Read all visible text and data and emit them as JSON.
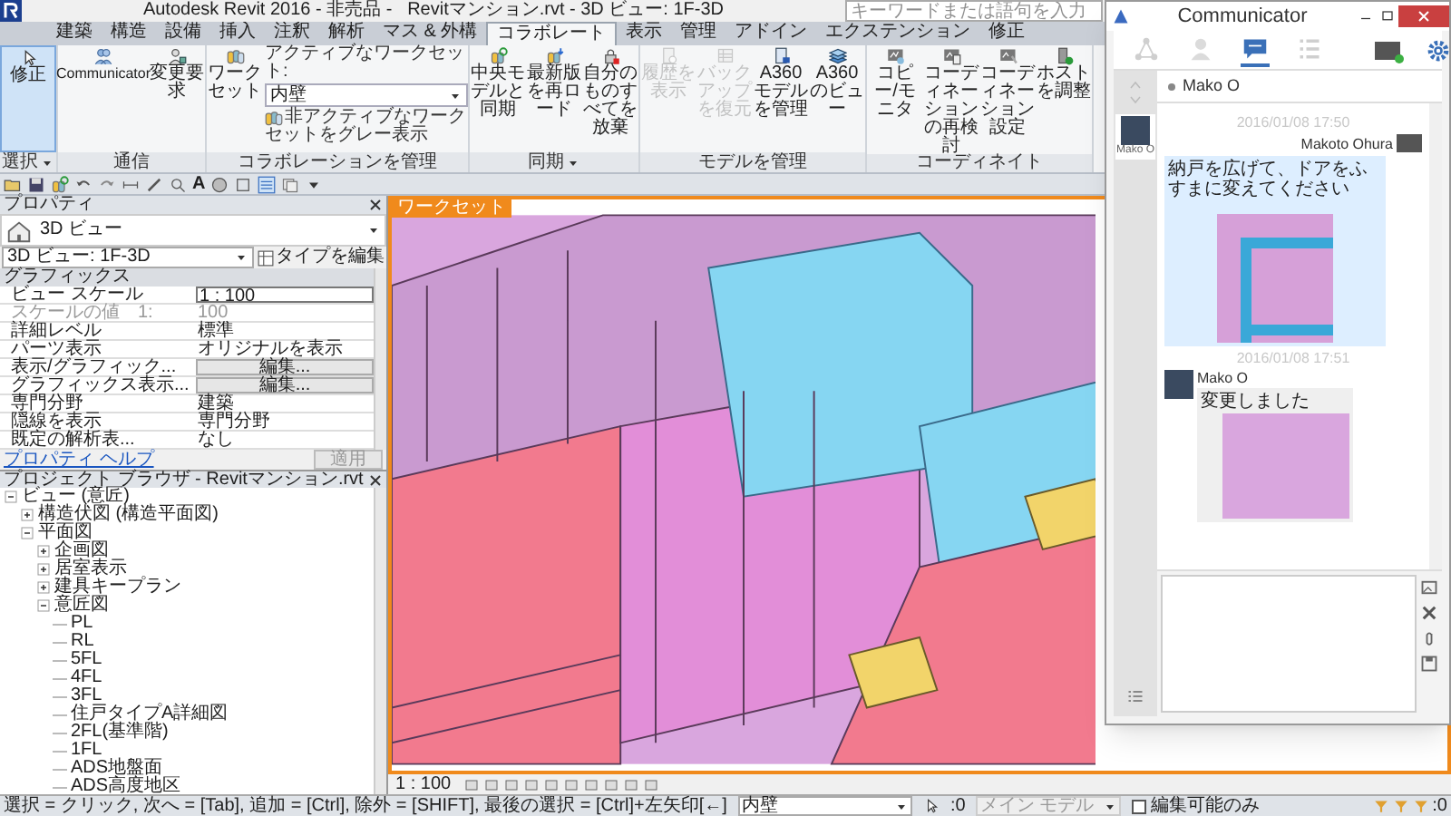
{
  "window": {
    "title": "Autodesk Revit 2016 - 非売品 -   Revitマンション.rvt - 3D ビュー: 1F-3D"
  },
  "search": {
    "placeholder": "キーワードまたは語句を入力"
  },
  "ribbon": {
    "tabs": [
      {
        "label": "建築",
        "selected": false
      },
      {
        "label": "構造",
        "selected": false
      },
      {
        "label": "設備",
        "selected": false
      },
      {
        "label": "挿入",
        "selected": false
      },
      {
        "label": "注釈",
        "selected": false
      },
      {
        "label": "解析",
        "selected": false
      },
      {
        "label": "マス & 外構",
        "selected": false
      },
      {
        "label": "コラボレート",
        "selected": true
      },
      {
        "label": "表示",
        "selected": false
      },
      {
        "label": "管理",
        "selected": false
      },
      {
        "label": "アドイン",
        "selected": false
      },
      {
        "label": "エクステンション",
        "selected": false
      },
      {
        "label": "修正",
        "selected": false
      }
    ],
    "groups": [
      {
        "title": "選択",
        "menu": true,
        "items": [
          {
            "kind": "button",
            "label": "修正",
            "selected": true,
            "disabled": false
          }
        ]
      },
      {
        "title": "通信",
        "menu": false,
        "items": [
          {
            "kind": "button",
            "label": "Communicator",
            "selected": false,
            "disabled": false
          },
          {
            "kind": "button",
            "label": "変更要求",
            "selected": false,
            "disabled": false
          }
        ]
      },
      {
        "title": "コラボレーションを管理",
        "menu": false,
        "items": [
          {
            "kind": "button",
            "label": "ワークセット",
            "selected": false,
            "disabled": false
          },
          {
            "kind": "workset",
            "label": "アクティブなワークセット:",
            "value": "内壁",
            "option": "非アクティブなワークセットをグレー表示"
          }
        ]
      },
      {
        "title": "同期",
        "menu": true,
        "items": [
          {
            "kind": "button",
            "label": "中央モデルと同期",
            "selected": false,
            "disabled": false
          },
          {
            "kind": "button",
            "label": "最新版を再ロード",
            "selected": false,
            "disabled": false
          },
          {
            "kind": "button",
            "label": "自分のものすべてを放棄",
            "selected": false,
            "disabled": false
          }
        ]
      },
      {
        "title": "モデルを管理",
        "menu": false,
        "items": [
          {
            "kind": "button",
            "label": "履歴を表示",
            "selected": false,
            "disabled": true
          },
          {
            "kind": "button",
            "label": "バックアップを復元",
            "selected": false,
            "disabled": true
          },
          {
            "kind": "button",
            "label": "A360 モデルを管理",
            "selected": false,
            "disabled": false
          },
          {
            "kind": "button",
            "label": "A360 のビュー",
            "selected": false,
            "disabled": false
          }
        ]
      },
      {
        "title": "コーディネイト",
        "menu": false,
        "items": [
          {
            "kind": "button",
            "label": "コピー/モニタ",
            "selected": false,
            "disabled": false
          },
          {
            "kind": "button",
            "label": "コーディネーションの再検討",
            "selected": false,
            "disabled": false
          },
          {
            "kind": "button",
            "label": "コーディネーション設定",
            "selected": false,
            "disabled": false
          },
          {
            "kind": "button",
            "label": "ホストを調整",
            "selected": false,
            "disabled": false
          }
        ]
      }
    ]
  },
  "quick_access": {
    "text_tool": "A"
  },
  "properties": {
    "title": "プロパティ",
    "type": "3D ビュー",
    "instance": "3D ビュー: 1F-3D",
    "edit_type": "タイプを編集",
    "section": "グラフィックス",
    "rows": [
      {
        "kind": "input",
        "name": "ビュー スケール",
        "value": "1 : 100"
      },
      {
        "kind": "readonly",
        "name": "スケールの値　1:",
        "value": "100"
      },
      {
        "kind": "text",
        "name": "詳細レベル",
        "value": "標準"
      },
      {
        "kind": "text",
        "name": "パーツ表示",
        "value": "オリジナルを表示"
      },
      {
        "kind": "button",
        "name": "表示/グラフィック...",
        "value": "編集..."
      },
      {
        "kind": "button",
        "name": "グラフィックス表示...",
        "value": "編集..."
      },
      {
        "kind": "text",
        "name": "専門分野",
        "value": "建築"
      },
      {
        "kind": "text",
        "name": "隠線を表示",
        "value": "専門分野"
      },
      {
        "kind": "text",
        "name": "既定の解析表...",
        "value": "なし"
      }
    ],
    "help": "プロパティ ヘルプ",
    "apply": "適用"
  },
  "project_browser": {
    "title": "プロジェクト ブラウザ - Revitマンション.rvt",
    "tree": [
      {
        "label": "ビュー (意匠)",
        "expanded": true,
        "children": [
          {
            "label": "構造伏図 (構造平面図)",
            "expanded": false
          },
          {
            "label": "平面図",
            "expanded": true,
            "children": [
              {
                "label": "企画図",
                "expanded": false
              },
              {
                "label": "居室表示",
                "expanded": false
              },
              {
                "label": "建具キープラン",
                "expanded": false
              },
              {
                "label": "意匠図",
                "expanded": true,
                "children": [
                  {
                    "label": "PL"
                  },
                  {
                    "label": "RL"
                  },
                  {
                    "label": "5FL"
                  },
                  {
                    "label": "4FL"
                  },
                  {
                    "label": "3FL"
                  },
                  {
                    "label": "住戸タイプA詳細図"
                  },
                  {
                    "label": "2FL(基準階)"
                  },
                  {
                    "label": "1FL"
                  },
                  {
                    "label": "ADS地盤面"
                  },
                  {
                    "label": "ADS高度地区"
                  }
                ]
              }
            ]
          }
        ]
      }
    ]
  },
  "viewport": {
    "label": "ワークセット",
    "scale": "1 : 100"
  },
  "status_bar": {
    "hint": "選択 = クリック, 次へ = [Tab], 追加 = [Ctrl], 除外 = [SHIFT], 最後の選択 = [Ctrl]+左矢印[←]",
    "workset": "内壁",
    "count": ":0",
    "model": "メイン モデル",
    "editable_only": {
      "label": "編集可能のみ",
      "checked": false
    },
    "filter_count": ":0"
  },
  "communicator": {
    "title": "Communicator",
    "tabs": [
      {
        "kind": "network",
        "selected": false
      },
      {
        "kind": "contacts",
        "selected": false
      },
      {
        "kind": "chat",
        "selected": true
      },
      {
        "kind": "list",
        "selected": false
      }
    ],
    "contacts": [
      {
        "name": "Mako O",
        "selected": true
      }
    ],
    "conversation": {
      "contact": "Mako O"
    },
    "messages": [
      {
        "kind": "outgoing",
        "timestamp": "2016/01/08 17:50",
        "sender": "Makoto Ohura",
        "text": "納戸を広げて、ドアをふすまに変えてください"
      },
      {
        "kind": "incoming",
        "timestamp": "2016/01/08 17:51",
        "sender": "Mako O",
        "text": "変更しました"
      }
    ]
  }
}
